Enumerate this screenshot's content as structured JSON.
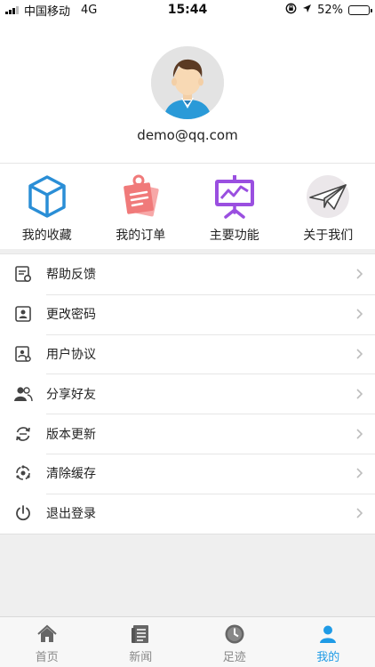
{
  "status_bar": {
    "carrier": "中国移动",
    "network": "4G",
    "time": "15:44",
    "battery_percent": "52%",
    "battery_level": 0.52
  },
  "profile": {
    "email": "demo@qq.com",
    "avatar_icon": "user-avatar-icon"
  },
  "quick_actions": [
    {
      "label": "我的收藏",
      "icon": "cube-icon",
      "color": "#2a8ed6"
    },
    {
      "label": "我的订单",
      "icon": "order-notes-icon",
      "color": "#f07a7a"
    },
    {
      "label": "主要功能",
      "icon": "presentation-chart-icon",
      "color": "#9a4fe0"
    },
    {
      "label": "关于我们",
      "icon": "paper-plane-icon",
      "color": "#555555"
    }
  ],
  "menu": [
    {
      "label": "帮助反馈",
      "icon": "feedback-icon"
    },
    {
      "label": "更改密码",
      "icon": "password-icon"
    },
    {
      "label": "用户协议",
      "icon": "agreement-icon"
    },
    {
      "label": "分享好友",
      "icon": "share-friends-icon"
    },
    {
      "label": "版本更新",
      "icon": "update-icon"
    },
    {
      "label": "清除缓存",
      "icon": "clear-cache-icon"
    },
    {
      "label": "退出登录",
      "icon": "power-icon"
    }
  ],
  "tabs": [
    {
      "label": "首页",
      "icon": "home-icon"
    },
    {
      "label": "新闻",
      "icon": "news-icon"
    },
    {
      "label": "足迹",
      "icon": "clock-icon"
    },
    {
      "label": "我的",
      "icon": "user-icon",
      "active": true
    }
  ],
  "colors": {
    "active_tab": "#1f9be6",
    "inactive_tab": "#888888"
  }
}
